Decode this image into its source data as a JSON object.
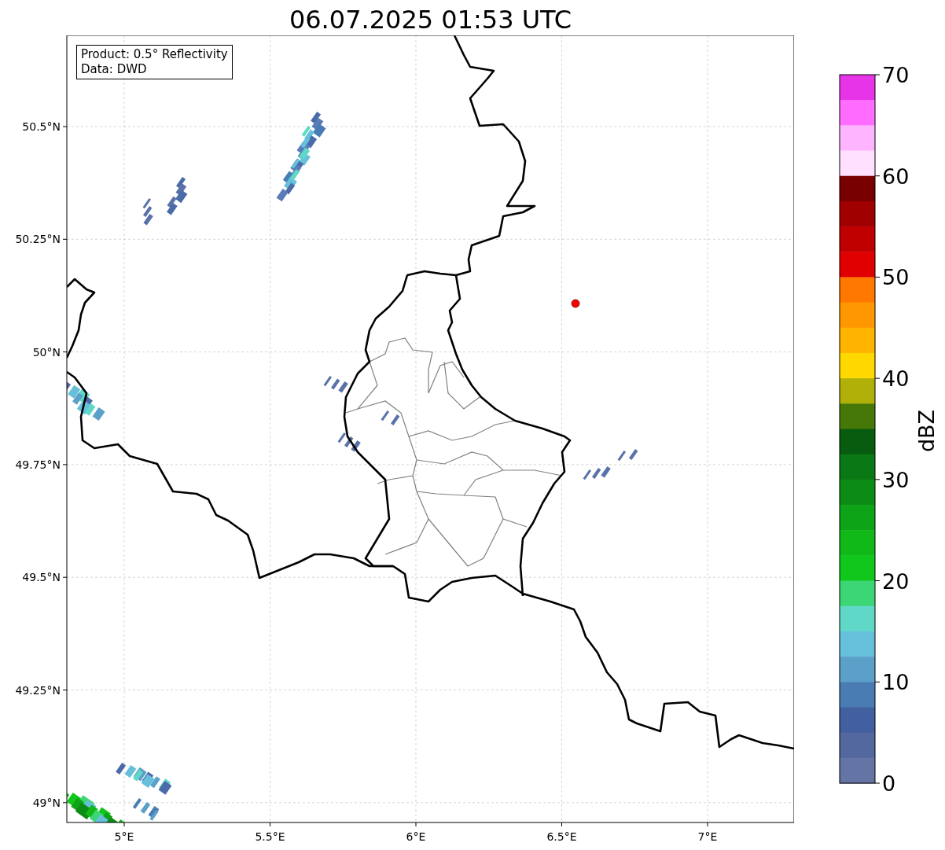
{
  "title": "06.07.2025 01:53 UTC",
  "info_box": {
    "lines": [
      "Product: 0.5° Reflectivity",
      "Data: DWD"
    ]
  },
  "map": {
    "x_ticks": [
      "5°E",
      "5.5°E",
      "6°E",
      "6.5°E",
      "7°E"
    ],
    "y_ticks": [
      "50.5°N",
      "50.25°N",
      "50°N",
      "49.75°N",
      "49.5°N",
      "49.25°N",
      "49°N"
    ]
  },
  "colorbar": {
    "label": "dBZ",
    "ticks": [
      "70",
      "60",
      "50",
      "40",
      "30",
      "20",
      "10",
      "0"
    ],
    "bins": [
      {
        "color": "#e834e8"
      },
      {
        "color": "#ff6cff"
      },
      {
        "color": "#ffb4ff"
      },
      {
        "color": "#ffe0ff"
      },
      {
        "color": "#780000"
      },
      {
        "color": "#a00000"
      },
      {
        "color": "#c00000"
      },
      {
        "color": "#e00000"
      },
      {
        "color": "#ff7800"
      },
      {
        "color": "#ff9800"
      },
      {
        "color": "#ffb400"
      },
      {
        "color": "#ffd800"
      },
      {
        "color": "#b0b008"
      },
      {
        "color": "#467808"
      },
      {
        "color": "#085c10"
      },
      {
        "color": "#0a7814"
      },
      {
        "color": "#0c8c14"
      },
      {
        "color": "#0ea418"
      },
      {
        "color": "#10b818"
      },
      {
        "color": "#10c81c"
      },
      {
        "color": "#3cd674"
      },
      {
        "color": "#60d8c8"
      },
      {
        "color": "#66c0dc"
      },
      {
        "color": "#5aa0c8"
      },
      {
        "color": "#4a7cb4"
      },
      {
        "color": "#425fa0"
      },
      {
        "color": "#52689e"
      },
      {
        "color": "#6474a4"
      }
    ]
  }
}
